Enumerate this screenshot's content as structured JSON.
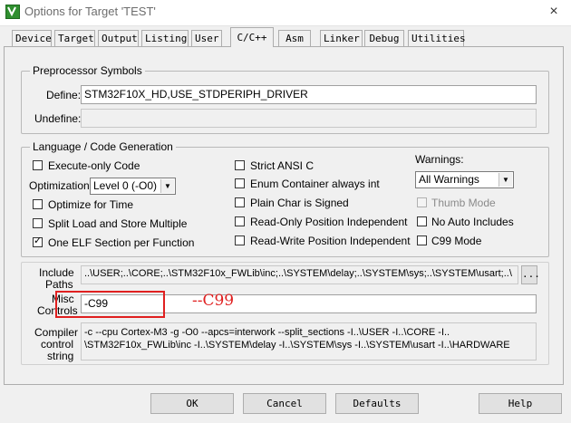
{
  "window": {
    "title": "Options for Target 'TEST'",
    "close_glyph": "×"
  },
  "tabs": [
    {
      "label": "Device"
    },
    {
      "label": "Target"
    },
    {
      "label": "Output"
    },
    {
      "label": "Listing"
    },
    {
      "label": "User"
    },
    {
      "label": "C/C++",
      "active": true
    },
    {
      "label": "Asm"
    },
    {
      "label": "Linker"
    },
    {
      "label": "Debug"
    },
    {
      "label": "Utilities"
    }
  ],
  "preprocessor": {
    "legend": "Preprocessor Symbols",
    "define_label": "Define:",
    "define_value": "STM32F10X_HD,USE_STDPERIPH_DRIVER",
    "undefine_label": "Undefine:",
    "undefine_value": ""
  },
  "language": {
    "legend": "Language / Code Generation",
    "execute_only": {
      "label": "Execute-only Code",
      "checked": false
    },
    "optimization_label": "Optimization:",
    "optimization_value": "Level 0 (-O0)",
    "optimize_time": {
      "label": "Optimize for Time",
      "checked": false
    },
    "split_load": {
      "label": "Split Load and Store Multiple",
      "checked": false
    },
    "one_elf": {
      "label": "One ELF Section per Function",
      "checked": true
    },
    "strict_ansi": {
      "label": "Strict ANSI C",
      "checked": false
    },
    "enum_container": {
      "label": "Enum Container always int",
      "checked": false
    },
    "plain_char": {
      "label": "Plain Char is Signed",
      "checked": false
    },
    "ro_pi": {
      "label": "Read-Only Position Independent",
      "checked": false
    },
    "rw_pi": {
      "label": "Read-Write Position Independent",
      "checked": false
    },
    "warnings_label": "Warnings:",
    "warnings_value": "All Warnings",
    "thumb_mode": {
      "label": "Thumb Mode",
      "checked": false,
      "disabled": true
    },
    "no_auto_includes": {
      "label": "No Auto Includes",
      "checked": false
    },
    "c99_mode": {
      "label": "C99 Mode",
      "checked": false
    }
  },
  "include_paths": {
    "label_line1": "Include",
    "label_line2": "Paths",
    "value": "..\\USER;..\\CORE;..\\STM32F10x_FWLib\\inc;..\\SYSTEM\\delay;..\\SYSTEM\\sys;..\\SYSTEM\\usart;..\\",
    "browse_label": "..."
  },
  "misc_controls": {
    "label_line1": "Misc",
    "label_line2": "Controls",
    "value": "-C99",
    "annotation": "--C99"
  },
  "compiler_string": {
    "label_line1": "Compiler",
    "label_line2": "control",
    "label_line3": "string",
    "line1": "-c --cpu Cortex-M3 -g -O0 --apcs=interwork --split_sections -I..\\USER -I..\\CORE -I..",
    "line2": "\\STM32F10x_FWLib\\inc -I..\\SYSTEM\\delay -I..\\SYSTEM\\sys -I..\\SYSTEM\\usart -I..\\HARDWARE"
  },
  "buttons": {
    "ok": "OK",
    "cancel": "Cancel",
    "defaults": "Defaults",
    "help": "Help"
  },
  "icons": {
    "app": "keil-uvision-icon",
    "close": "close-icon",
    "check": "checkmark-icon",
    "dropdown": "chevron-down-icon"
  }
}
